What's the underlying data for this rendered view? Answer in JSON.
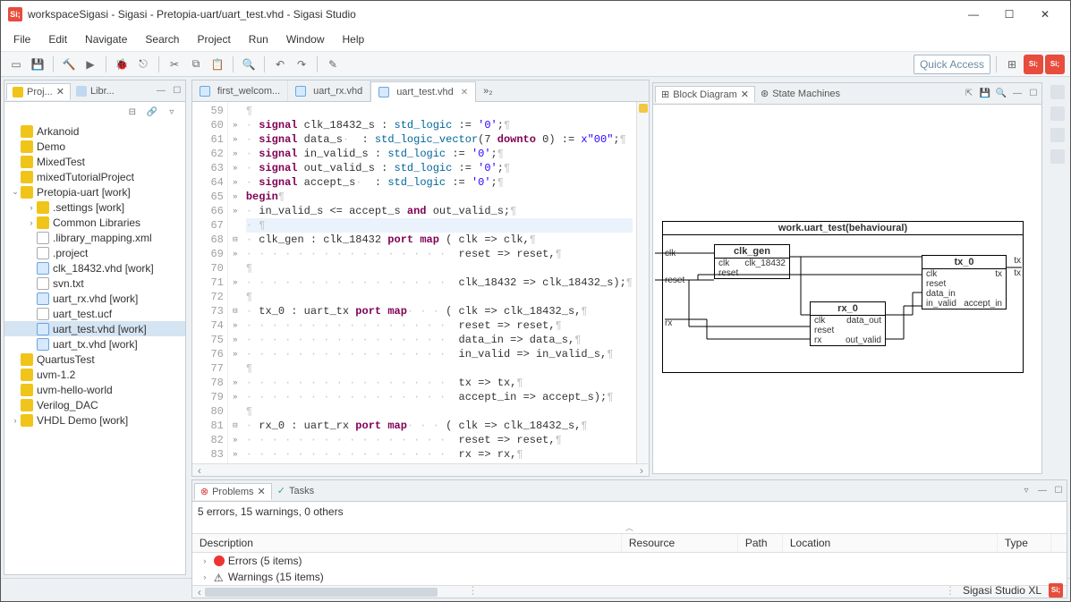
{
  "window": {
    "title": "workspaceSigasi - Sigasi - Pretopia-uart/uart_test.vhd - Sigasi Studio",
    "app_icon_text": "Si;"
  },
  "menu": [
    "File",
    "Edit",
    "Navigate",
    "Search",
    "Project",
    "Run",
    "Window",
    "Help"
  ],
  "quick_access": "Quick Access",
  "views": {
    "project_explorer": {
      "tab_label_short": "Proj...",
      "lib_tab": "Libr..."
    }
  },
  "tree": [
    {
      "l": 0,
      "arrow": "",
      "icon": "prj",
      "label": "Arkanoid"
    },
    {
      "l": 0,
      "arrow": "",
      "icon": "prj",
      "label": "Demo"
    },
    {
      "l": 0,
      "arrow": "",
      "icon": "prj",
      "label": "MixedTest"
    },
    {
      "l": 0,
      "arrow": "",
      "icon": "prj",
      "label": "mixedTutorialProject"
    },
    {
      "l": 0,
      "arrow": "v",
      "icon": "prj",
      "label": "Pretopia-uart [work]"
    },
    {
      "l": 1,
      "arrow": ">",
      "icon": "fold",
      "label": ".settings [work]"
    },
    {
      "l": 1,
      "arrow": ">",
      "icon": "fold",
      "label": "Common Libraries"
    },
    {
      "l": 1,
      "arrow": "",
      "icon": "file",
      "label": ".library_mapping.xml"
    },
    {
      "l": 1,
      "arrow": "",
      "icon": "file",
      "label": ".project"
    },
    {
      "l": 1,
      "arrow": "",
      "icon": "vhd",
      "label": "clk_18432.vhd [work]"
    },
    {
      "l": 1,
      "arrow": "",
      "icon": "file",
      "label": "svn.txt"
    },
    {
      "l": 1,
      "arrow": "",
      "icon": "vhd",
      "label": "uart_rx.vhd [work]"
    },
    {
      "l": 1,
      "arrow": "",
      "icon": "file",
      "label": "uart_test.ucf"
    },
    {
      "l": 1,
      "arrow": "",
      "icon": "vhd",
      "label": "uart_test.vhd [work]",
      "selected": true
    },
    {
      "l": 1,
      "arrow": "",
      "icon": "vhd",
      "label": "uart_tx.vhd [work]"
    },
    {
      "l": 0,
      "arrow": "",
      "icon": "prj",
      "label": "QuartusTest"
    },
    {
      "l": 0,
      "arrow": "",
      "icon": "prj",
      "label": "uvm-1.2"
    },
    {
      "l": 0,
      "arrow": "",
      "icon": "prj",
      "label": "uvm-hello-world"
    },
    {
      "l": 0,
      "arrow": "",
      "icon": "prj",
      "label": "Verilog_DAC"
    },
    {
      "l": 0,
      "arrow": ">",
      "icon": "prj",
      "label": "VHDL Demo [work]"
    }
  ],
  "editor_tabs": [
    {
      "label": "first_welcom...",
      "active": false,
      "icon": "vhd"
    },
    {
      "label": "uart_rx.vhd",
      "active": false,
      "icon": "vhd"
    },
    {
      "label": "uart_test.vhd",
      "active": true,
      "icon": "vhd"
    }
  ],
  "editor_overflow": "»₂",
  "editor": {
    "first_line": 59,
    "lines": [
      "",
      "  signal clk_18432_s : std_logic := '0';",
      "  signal data_s   : std_logic_vector(7 downto 0) := x\"00\";",
      "  signal in_valid_s : std_logic := '0';",
      "  signal out_valid_s : std_logic := '0';",
      "  signal accept_s   : std_logic := '0';",
      "begin",
      "  in_valid_s <= accept_s and out_valid_s;",
      "  ",
      "  clk_gen : clk_18432 port map ( clk => clk,",
      "                                 reset => reset,",
      "",
      "                                 clk_18432 => clk_18432_s);",
      "",
      "  tx_0 : uart_tx port map      ( clk => clk_18432_s,",
      "                                 reset => reset,",
      "                                 data_in => data_s,",
      "                                 in_valid => in_valid_s,",
      "",
      "                                 tx => tx,",
      "                                 accept_in => accept_s);",
      "",
      "  rx_0 : uart_rx port map      ( clk => clk_18432_s,",
      "                                 reset => reset,",
      "                                 rx => rx,"
    ],
    "hl_line_index": 8
  },
  "diagram": {
    "tab1": "Block Diagram",
    "tab2": "State Machines",
    "title": "work.uart_test(behavioural)",
    "outer_ports_left": [
      "clk",
      "reset",
      "rx"
    ],
    "outer_ports_right": [
      "tx",
      "tx"
    ],
    "blocks": {
      "clk_gen": {
        "name": "clk_gen",
        "ports_l": [
          "clk",
          "reset"
        ],
        "ports_r": [
          "clk_18432"
        ]
      },
      "rx_0": {
        "name": "rx_0",
        "ports_l": [
          "clk",
          "reset",
          "rx"
        ],
        "ports_r": [
          "data_out",
          "",
          "out_valid"
        ]
      },
      "tx_0": {
        "name": "tx_0",
        "ports_l": [
          "clk",
          "reset",
          "data_in",
          "in_valid"
        ],
        "ports_r": [
          "tx",
          "",
          "",
          "accept_in"
        ]
      }
    }
  },
  "problems": {
    "tab1": "Problems",
    "tab2": "Tasks",
    "summary": "5 errors, 15 warnings, 0 others",
    "cols": [
      "Description",
      "Resource",
      "Path",
      "Location",
      "Type"
    ],
    "groups": [
      {
        "icon": "err",
        "label": "Errors (5 items)"
      },
      {
        "icon": "warn",
        "label": "Warnings (15 items)"
      }
    ]
  },
  "status": {
    "product": "Sigasi Studio XL",
    "badge": "Si;"
  }
}
